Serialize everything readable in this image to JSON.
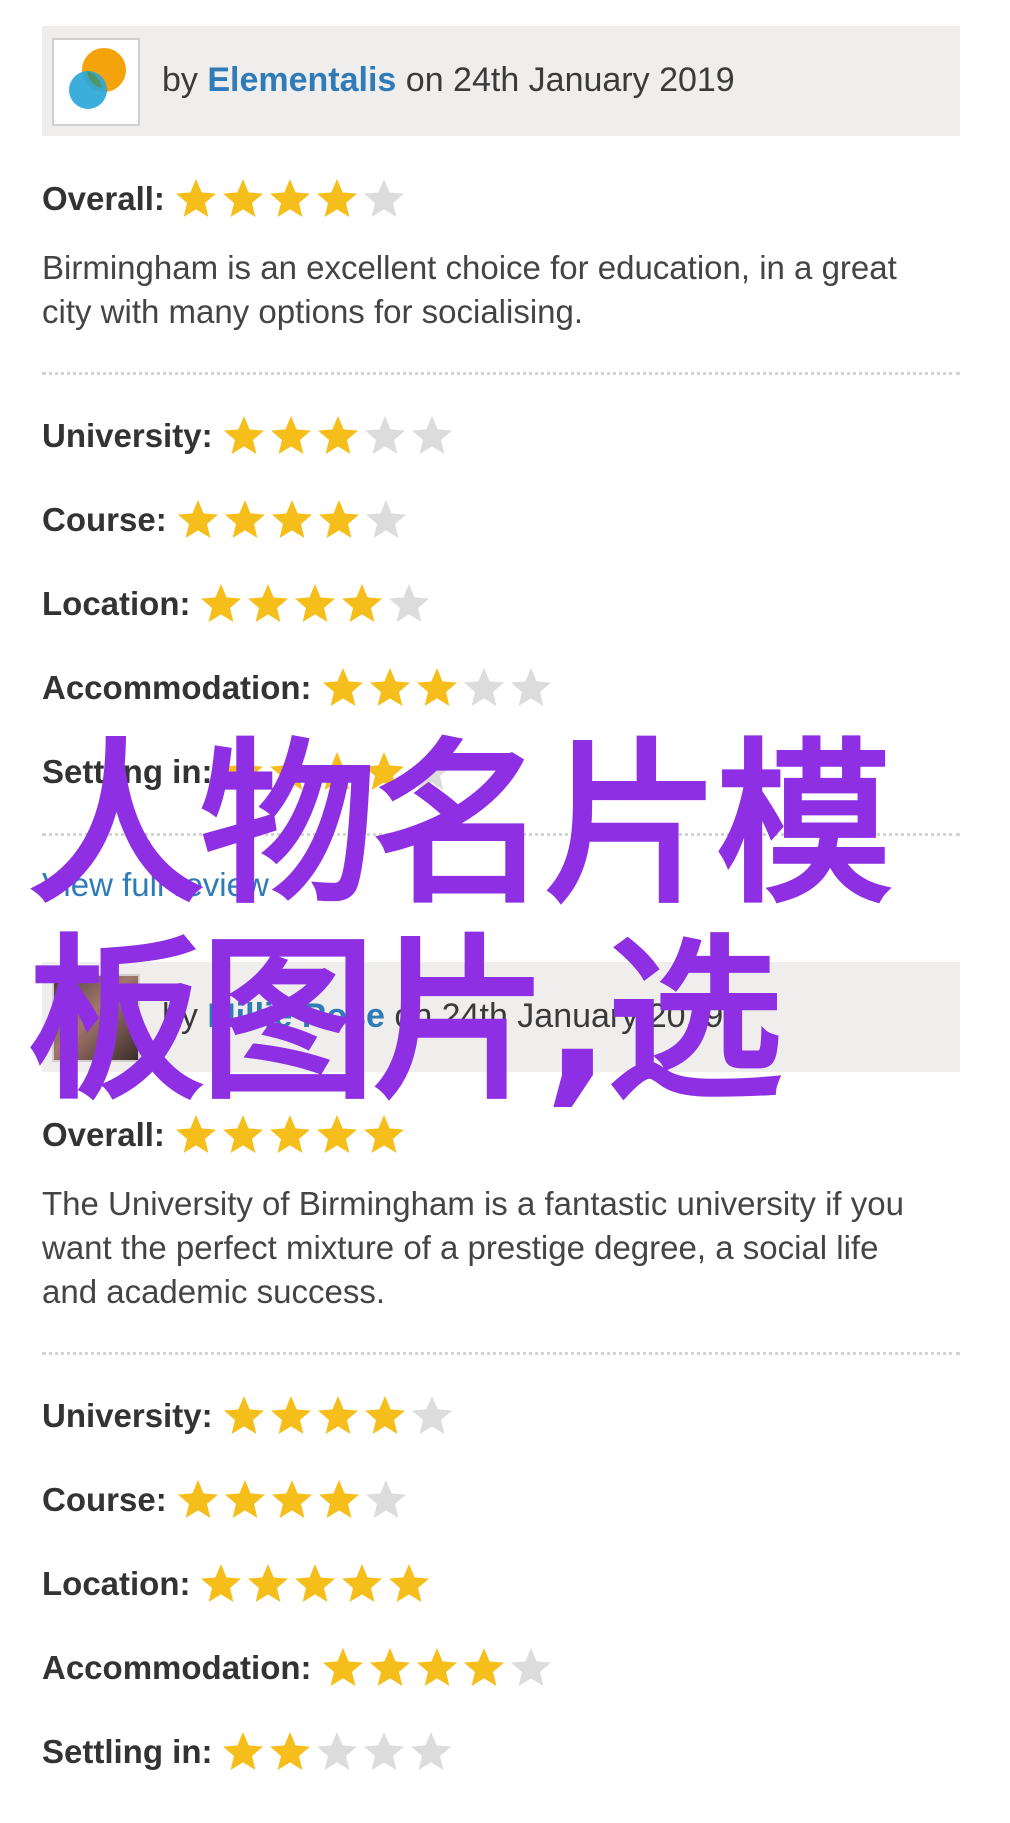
{
  "reviews": [
    {
      "byline_prefix": "by ",
      "author": "Elementalis",
      "byline_suffix": " on 24th January 2019",
      "overall_label": "Overall:",
      "overall_stars": 4,
      "text": "Birmingham is an excellent choice for education, in a great city with many options for socialising.",
      "ratings": [
        {
          "label": "University:",
          "stars": 3
        },
        {
          "label": "Course:",
          "stars": 4
        },
        {
          "label": "Location:",
          "stars": 4
        },
        {
          "label": "Accommodation:",
          "stars": 3
        },
        {
          "label": "Settling in:",
          "stars": 4
        }
      ],
      "link_label": "View full review"
    },
    {
      "byline_prefix": "by ",
      "author": "Millie Rose",
      "byline_suffix": " on 24th January 2019",
      "overall_label": "Overall:",
      "overall_stars": 5,
      "text": "The University of Birmingham is a fantastic university if you want the perfect mixture of a prestige degree, a social life and academic success.",
      "ratings": [
        {
          "label": "University:",
          "stars": 4
        },
        {
          "label": "Course:",
          "stars": 4
        },
        {
          "label": "Location:",
          "stars": 5
        },
        {
          "label": "Accommodation:",
          "stars": 4
        },
        {
          "label": "Settling in:",
          "stars": 2
        }
      ]
    }
  ],
  "max_stars": 5,
  "colors": {
    "star_filled": "#f6be1b",
    "star_empty": "#dcdcdc",
    "link": "#2f7bb8",
    "overlay": "#8e2fe3"
  },
  "icons": {
    "logo": "elementalis-logo-icon",
    "star": "star-icon"
  },
  "overlay_text": "人物名片模板图片,选"
}
